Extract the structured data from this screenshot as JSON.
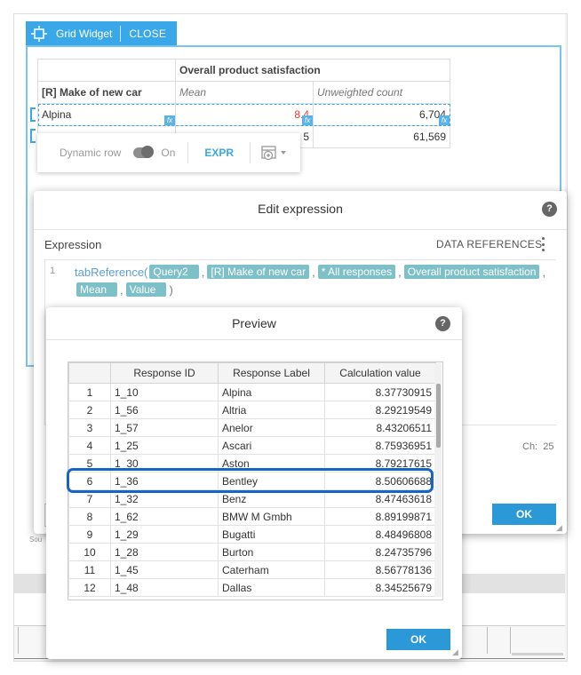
{
  "widget": {
    "title": "Grid Widget",
    "close_label": "CLOSE"
  },
  "grid": {
    "header_group": "Overall product satisfaction",
    "row_header": "[R] Make of new car",
    "col_mean": "Mean",
    "col_unweighted": "Unweighted count",
    "rows": [
      {
        "label": "Alpina",
        "mean": "8.4",
        "count": "6,704"
      },
      {
        "label": "",
        "mean": "5",
        "count": "61,569"
      }
    ],
    "fx_label": "fx"
  },
  "dynamic_row": {
    "label": "Dynamic row",
    "state": "On",
    "expr_label": "EXPR"
  },
  "edit_dialog": {
    "title": "Edit expression",
    "help": "?",
    "expression_label": "Expression",
    "data_references_label": "DATA REFERENCES",
    "line_number": "1",
    "function_name": "tabReference(",
    "chips": [
      "Query2",
      "[R] Make of new car",
      "* All responses",
      "Overall product satisfaction",
      "Mean",
      "Value"
    ],
    "comma": ",",
    "close_paren": ")",
    "ch_label": "Ch:",
    "ch_value": "25",
    "ok_label": "OK"
  },
  "preview": {
    "title": "Preview",
    "help": "?",
    "columns": [
      "Response ID",
      "Response Label",
      "Calculation value"
    ],
    "rows": [
      {
        "n": "1",
        "id": "1_10",
        "label": "Alpina",
        "value": "8.37730915"
      },
      {
        "n": "2",
        "id": "1_56",
        "label": "Altria",
        "value": "8.29219549"
      },
      {
        "n": "3",
        "id": "1_57",
        "label": "Anelor",
        "value": "8.43206511"
      },
      {
        "n": "4",
        "id": "1_25",
        "label": "Ascari",
        "value": "8.75936951"
      },
      {
        "n": "5",
        "id": "1_30",
        "label": "Aston",
        "value": "8.79217615"
      },
      {
        "n": "6",
        "id": "1_36",
        "label": "Bentley",
        "value": "8.50606688"
      },
      {
        "n": "7",
        "id": "1_32",
        "label": "Benz",
        "value": "8.47463618"
      },
      {
        "n": "8",
        "id": "1_62",
        "label": "BMW M Gmbh",
        "value": "8.89199871"
      },
      {
        "n": "9",
        "id": "1_29",
        "label": "Bugatti",
        "value": "8.48496808"
      },
      {
        "n": "10",
        "id": "1_28",
        "label": "Burton",
        "value": "8.24735796"
      },
      {
        "n": "11",
        "id": "1_45",
        "label": "Caterham",
        "value": "8.56778136"
      },
      {
        "n": "12",
        "id": "1_48",
        "label": "Dallas",
        "value": "8.34525679"
      }
    ],
    "ok_label": "OK"
  },
  "background": {
    "source_label": "Sou"
  },
  "colors": {
    "accent": "#3aa8e8",
    "button": "#2b98d8",
    "chip": "#7ec0c7",
    "highlight": "#1664c4",
    "alert_value": "#e53935"
  }
}
